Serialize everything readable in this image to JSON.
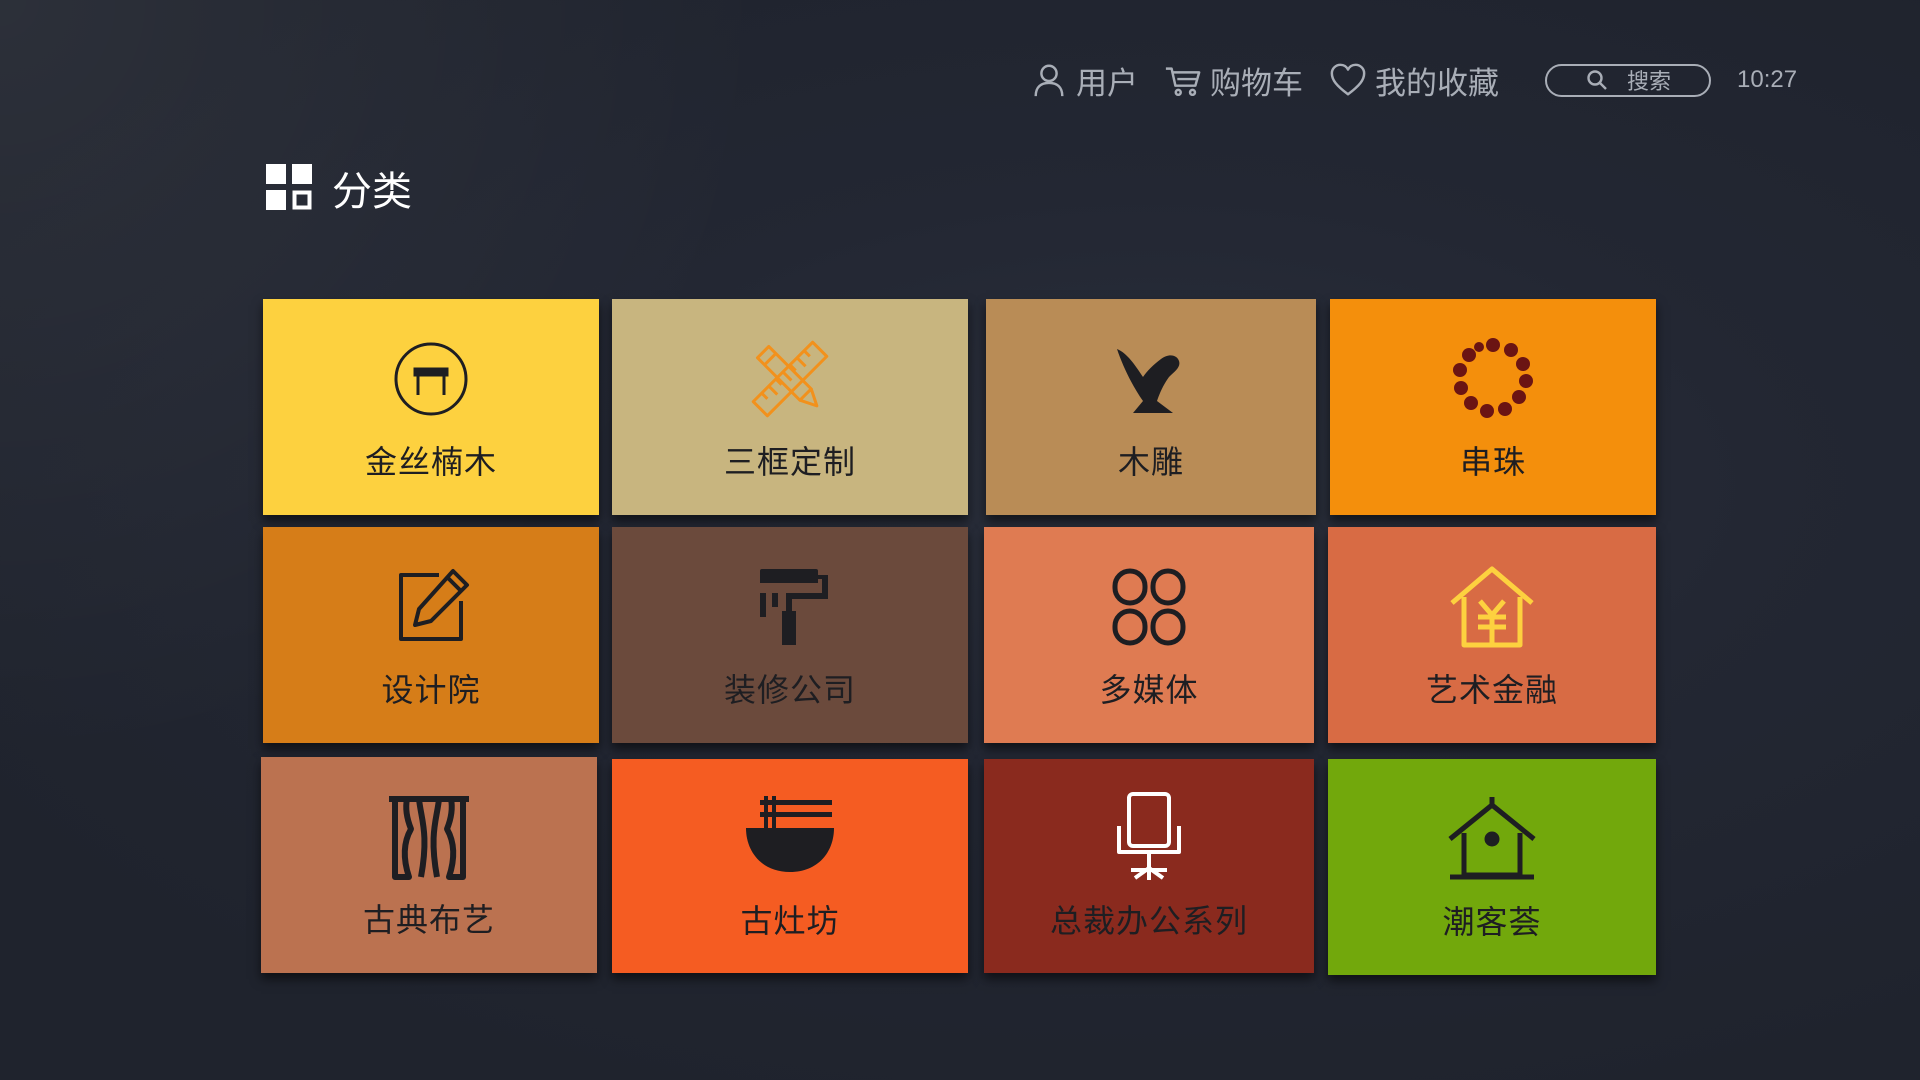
{
  "header": {
    "nav": [
      {
        "label": "用户",
        "icon": "user-icon"
      },
      {
        "label": "购物车",
        "icon": "cart-icon"
      },
      {
        "label": "我的收藏",
        "icon": "heart-icon"
      }
    ],
    "search": {
      "label": "搜索",
      "icon": "search-icon"
    },
    "clock": "10:27"
  },
  "section": {
    "title": "分类",
    "icon": "grid-icon"
  },
  "colors": {
    "text_dark": "#1e1e22",
    "nav_text": "#a9aeb7",
    "background": "#232733"
  },
  "tiles": [
    {
      "label": "金丝楠木",
      "icon": "stool-icon",
      "color": "#fdd13f"
    },
    {
      "label": "三框定制",
      "icon": "pencil-ruler-icon",
      "color": "#c8b57f"
    },
    {
      "label": "木雕",
      "icon": "bird-carving-icon",
      "color": "#b98c56"
    },
    {
      "label": "串珠",
      "icon": "bead-bracelet-icon",
      "color": "#f48f0c"
    },
    {
      "label": "设计院",
      "icon": "edit-icon",
      "color": "#d67d18"
    },
    {
      "label": "装修公司",
      "icon": "paint-roller-icon",
      "color": "#6b4a3c"
    },
    {
      "label": "多媒体",
      "icon": "command-icon",
      "color": "#df7b52"
    },
    {
      "label": "艺术金融",
      "icon": "yuan-house-icon",
      "color": "#d86b44"
    },
    {
      "label": "古典布艺",
      "icon": "curtain-icon",
      "color": "#bb7250"
    },
    {
      "label": "古灶坊",
      "icon": "noodle-bowl-icon",
      "color": "#f55c22"
    },
    {
      "label": "总裁办公系列",
      "icon": "office-chair-icon",
      "color": "#8a2a1e"
    },
    {
      "label": "潮客荟",
      "icon": "house-icon",
      "color": "#72a80c"
    }
  ]
}
